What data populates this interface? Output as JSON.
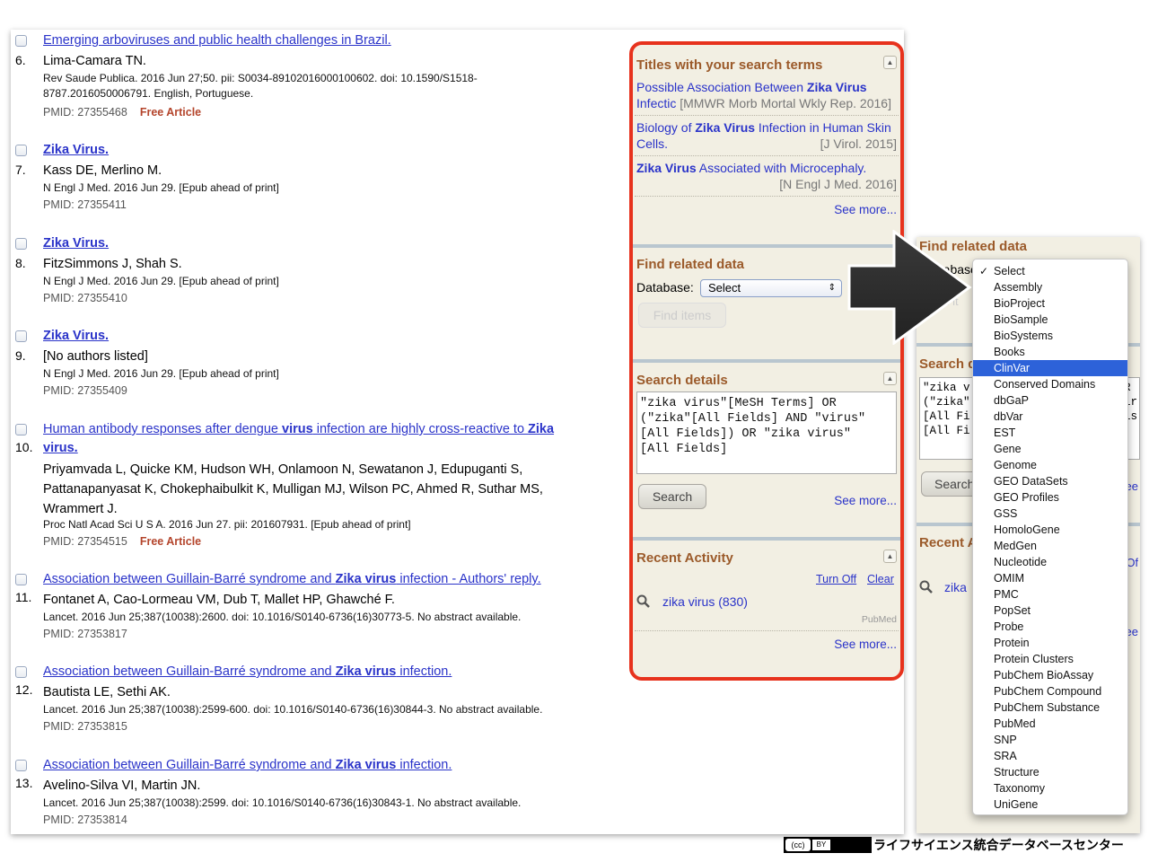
{
  "results": [
    {
      "title_plain": "Emerging arboviruses and public health challenges in Brazil.",
      "num": "6.",
      "authors": "Lima-Camara TN.",
      "cite": "Rev Saude Publica. 2016 Jun 27;50. pii: S0034-89102016000100602. doi: 10.1590/S1518-8787.2016050006791. English, Portuguese.",
      "pmid": "PMID: 27355468",
      "free": "Free Article"
    },
    {
      "title_plain": "Zika Virus.",
      "num": "7.",
      "authors": "Kass DE, Merlino M.",
      "cite": "N Engl J Med. 2016 Jun 29. [Epub ahead of print]",
      "pmid": "PMID: 27355411"
    },
    {
      "title_plain": "Zika Virus.",
      "num": "8.",
      "authors": "FitzSimmons J, Shah S.",
      "cite": "N Engl J Med. 2016 Jun 29. [Epub ahead of print]",
      "pmid": "PMID: 27355410"
    },
    {
      "title_plain": "Zika Virus.",
      "num": "9.",
      "authors": "[No authors listed]",
      "cite": "N Engl J Med. 2016 Jun 29. [Epub ahead of print]",
      "pmid": "PMID: 27355409"
    },
    {
      "title_part1": "Human antibody responses after dengue ",
      "title_bold1": "virus",
      "title_part2": " infection are highly cross-reactive to ",
      "title_bold2": "Zika",
      "title_line2": "virus.",
      "num": "10.",
      "authors": "Priyamvada L, Quicke KM, Hudson WH, Onlamoon N, Sewatanon J, Edupuganti S, Pattanapanyasat K, Chokephaibulkit K, Mulligan MJ, Wilson PC, Ahmed R, Suthar MS, Wrammert J.",
      "cite": "Proc Natl Acad Sci U S A. 2016 Jun 27. pii: 201607931. [Epub ahead of print]",
      "pmid": "PMID: 27354515",
      "free": "Free Article"
    },
    {
      "title_part1": "Association between Guillain-Barré syndrome and ",
      "title_bold1": "Zika virus",
      "title_part2": " infection - Authors' reply.",
      "num": "11.",
      "authors": "Fontanet A, Cao-Lormeau VM, Dub T, Mallet HP, Ghawché F.",
      "cite": "Lancet. 2016 Jun 25;387(10038):2600. doi: 10.1016/S0140-6736(16)30773-5. No abstract available.",
      "pmid": "PMID: 27353817"
    },
    {
      "title_part1": "Association between Guillain-Barré syndrome and ",
      "title_bold1": "Zika virus",
      "title_part2": " infection.",
      "num": "12.",
      "authors": "Bautista LE, Sethi AK.",
      "cite": "Lancet. 2016 Jun 25;387(10038):2599-600. doi: 10.1016/S0140-6736(16)30844-3. No abstract available.",
      "pmid": "PMID: 27353815"
    },
    {
      "title_part1": "Association between Guillain-Barré syndrome and ",
      "title_bold1": "Zika virus",
      "title_part2": " infection.",
      "num": "13.",
      "authors": "Avelino-Silva VI, Martin JN.",
      "cite": "Lancet. 2016 Jun 25;387(10038):2599. doi: 10.1016/S0140-6736(16)30843-1. No abstract available.",
      "pmid": "PMID: 27353814"
    }
  ],
  "sidebar": {
    "titles_heading": "Titles with your search terms",
    "titles": [
      {
        "a": "Possible Association Between ",
        "b": "Zika Virus",
        "c": "Infectic",
        "src": "[MMWR Morb Mortal Wkly Rep. 2016]"
      },
      {
        "a": "Biology of ",
        "b": "Zika Virus",
        "c": " Infection in Human Skin Cells.",
        "src": "[J Virol. 2015]"
      },
      {
        "a": "",
        "b": "Zika Virus",
        "c": " Associated with Microcephaly.",
        "src": "[N Engl J Med. 2016]"
      }
    ],
    "see_more": "See more...",
    "related_heading": "Find related data",
    "database_label": "Database:",
    "database_value": "Select",
    "find_items": "Find items",
    "details_heading": "Search details",
    "details_query": "\"zika virus\"[MeSH Terms] OR\n(\"zika\"[All Fields] AND \"virus\"\n[All Fields]) OR \"zika virus\"\n[All Fields]",
    "search_button": "Search",
    "recent_heading": "Recent Activity",
    "turn_off": "Turn Off",
    "clear": "Clear",
    "recent_item": "zika virus (830)",
    "recent_db": "PubMed"
  },
  "second": {
    "related_heading": "Find related data",
    "database_label_partial": "atabase",
    "find_partial": "nd it",
    "search_heading_partial": "Search d",
    "query_partial": "\"zika v\n(\"zika\"\n[All Fi\n[All Fi",
    "query_right": "R\nir\nis",
    "search_partial": "Search",
    "see_partial": "ee",
    "recent_partial": "Recent A",
    "turn_partial": "Of",
    "zika_partial": "zika",
    "see2_partial": "ee"
  },
  "dropdown": {
    "options": [
      "Select",
      "Assembly",
      "BioProject",
      "BioSample",
      "BioSystems",
      "Books",
      "ClinVar",
      "Conserved Domains",
      "dbGaP",
      "dbVar",
      "EST",
      "Gene",
      "Genome",
      "GEO DataSets",
      "GEO Profiles",
      "GSS",
      "HomoloGene",
      "MedGen",
      "Nucleotide",
      "OMIM",
      "PMC",
      "PopSet",
      "Probe",
      "Protein",
      "Protein Clusters",
      "PubChem BioAssay",
      "PubChem Compound",
      "PubChem Substance",
      "PubMed",
      "SNP",
      "SRA",
      "Structure",
      "Taxonomy",
      "UniGene"
    ],
    "checked": "Select",
    "highlighted": "ClinVar"
  },
  "footer": {
    "cc": "(cc)",
    "by": "BY",
    "text": "ライフサイエンス統合データベースセンター"
  },
  "colors": {
    "accent_red": "#e7321d",
    "link_blue": "#2a33c9",
    "heading_brown": "#9b5a2a",
    "highlight_blue": "#2d62d9"
  }
}
